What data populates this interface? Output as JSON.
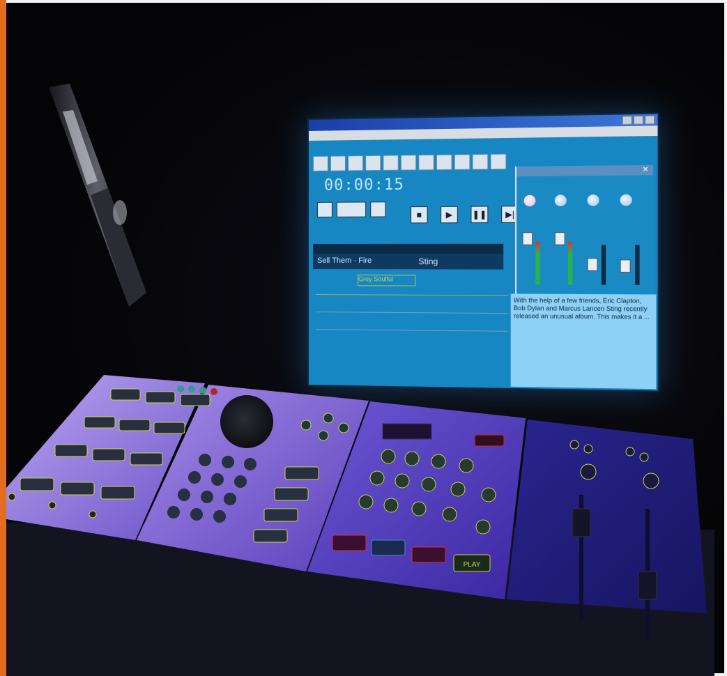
{
  "monitor": {
    "app_title": "",
    "time_display": "00:00:15",
    "track_label": "Sell Them · Fire",
    "track_sting": "Sting",
    "clip_label": "Grey Soulful",
    "info_title": "",
    "info_text": "With the help of a few friends, Eric Clapton, Bob Dylan and Marcus Lancen Sting recently released an unusual album. This makes it a ..."
  },
  "console": {
    "play_label": "PLAY"
  }
}
